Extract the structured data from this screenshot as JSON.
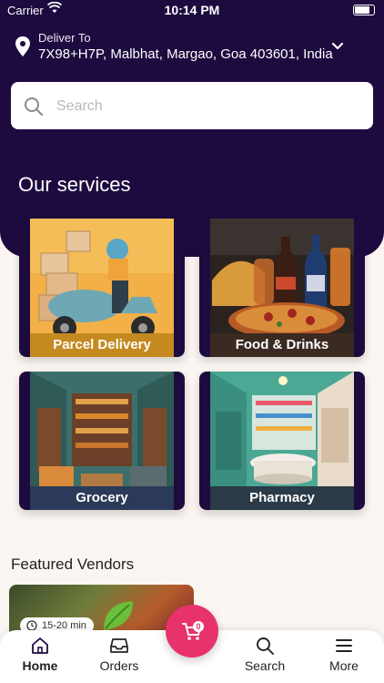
{
  "status_bar": {
    "carrier": "Carrier",
    "time": "10:14 PM"
  },
  "delivery": {
    "label": "Deliver To",
    "address": "7X98+H7P, Malbhat, Margao, Goa 403601, India"
  },
  "search": {
    "placeholder": "Search"
  },
  "services": {
    "title": "Our services",
    "items": [
      {
        "label": "Parcel Delivery"
      },
      {
        "label": "Food & Drinks"
      },
      {
        "label": "Grocery"
      },
      {
        "label": "Pharmacy"
      }
    ]
  },
  "featured": {
    "title": "Featured Vendors",
    "vendors": [
      {
        "delivery_time": "15-20 min"
      }
    ]
  },
  "cart": {
    "count": "0"
  },
  "tabs": [
    {
      "label": "Home",
      "icon": "home-icon"
    },
    {
      "label": "Orders",
      "icon": "inbox-icon"
    },
    {
      "label": "Search",
      "icon": "search-icon"
    },
    {
      "label": "More",
      "icon": "menu-icon"
    }
  ],
  "colors": {
    "header": "#1d0b3f",
    "accent": "#e8326b",
    "background": "#fbf6f1"
  }
}
